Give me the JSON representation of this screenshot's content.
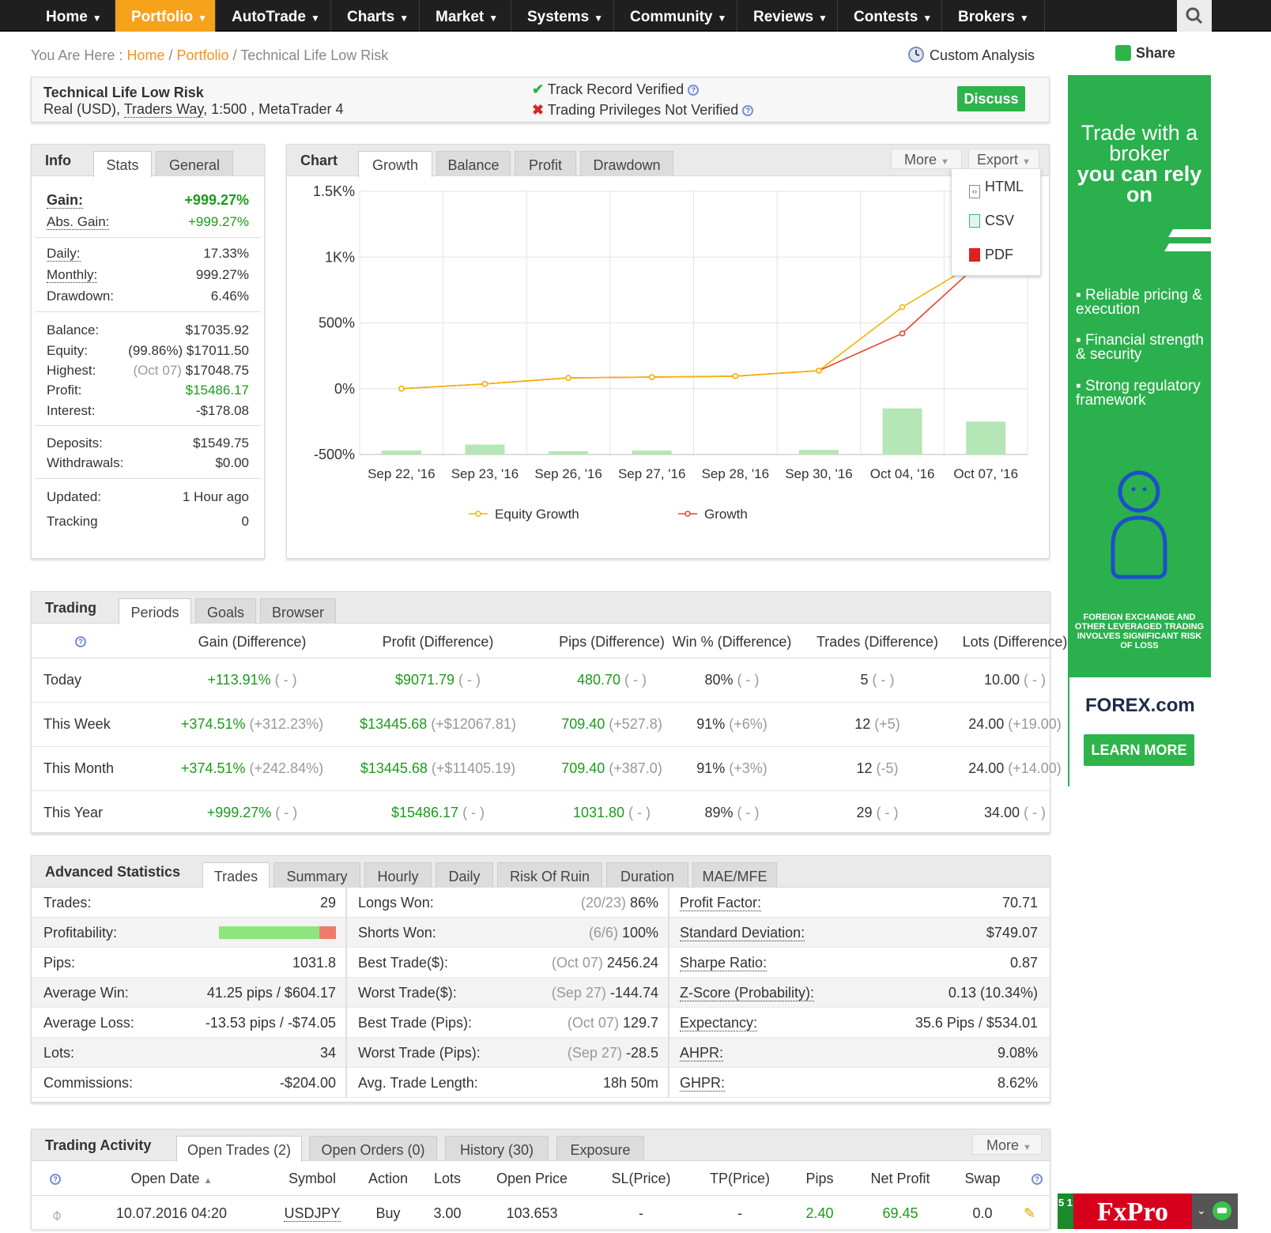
{
  "nav": {
    "items": [
      "Home",
      "Portfolio",
      "AutoTrade",
      "Charts",
      "Market",
      "Systems",
      "Community",
      "Reviews",
      "Contests",
      "Brokers"
    ],
    "active": "Portfolio"
  },
  "breadcrumb": {
    "prefix": "You Are Here :",
    "home": "Home",
    "portfolio": "Portfolio",
    "current": "Technical Life Low Risk"
  },
  "custom_analysis": "Custom Analysis",
  "share": "Share",
  "header": {
    "title": "Technical Life Low Risk",
    "sub_prefix": "Real (USD),",
    "broker": "Traders Way",
    "sub_suffix": ", 1:500 , MetaTrader 4",
    "track": "Track Record Verified",
    "privileges": "Trading Privileges Not Verified",
    "discuss": "Discuss"
  },
  "info": {
    "title": "Info",
    "tabs": [
      "Stats",
      "General"
    ],
    "gain_label": "Gain:",
    "gain": "+999.27%",
    "abs_gain_label": "Abs. Gain:",
    "abs_gain": "+999.27%",
    "daily_label": "Daily:",
    "daily": "17.33%",
    "monthly_label": "Monthly:",
    "monthly": "999.27%",
    "drawdown_label": "Drawdown:",
    "drawdown": "6.46%",
    "balance_label": "Balance:",
    "balance": "$17035.92",
    "equity_label": "Equity:",
    "equity_pct": "(99.86%)",
    "equity": "$17011.50",
    "highest_label": "Highest:",
    "highest_date": "(Oct 07)",
    "highest": "$17048.75",
    "profit_label": "Profit:",
    "profit": "$15486.17",
    "interest_label": "Interest:",
    "interest": "-$178.08",
    "deposits_label": "Deposits:",
    "deposits": "$1549.75",
    "withdrawals_label": "Withdrawals:",
    "withdrawals": "$0.00",
    "updated_label": "Updated:",
    "updated": "1 Hour ago",
    "tracking_label": "Tracking",
    "tracking": "0"
  },
  "chart_panel": {
    "title": "Chart",
    "tabs": [
      "Growth",
      "Balance",
      "Profit",
      "Drawdown"
    ],
    "more": "More",
    "export": "Export",
    "export_items": [
      "HTML",
      "CSV",
      "PDF"
    ]
  },
  "chart_data": {
    "type": "line",
    "categories": [
      "Sep 22, '16",
      "Sep 23, '16",
      "Sep 26, '16",
      "Sep 27, '16",
      "Sep 28, '16",
      "Sep 30, '16",
      "Oct 04, '16",
      "Oct 07, '16"
    ],
    "y_ticks": [
      "1.5K%",
      "1K%",
      "500%",
      "0%",
      "-500%"
    ],
    "ylim": [
      -500,
      1500
    ],
    "series": [
      {
        "name": "Equity Growth",
        "color": "#f5b400",
        "values": [
          0,
          36,
          82,
          88,
          95,
          137,
          620,
          999
        ]
      },
      {
        "name": "Growth",
        "color": "#e8422c",
        "values": [
          0,
          36,
          82,
          88,
          95,
          137,
          420,
          999
        ]
      }
    ],
    "bars": {
      "color": "#b5e6b5",
      "values": [
        -470,
        -425,
        -475,
        -470,
        -500,
        -465,
        -150,
        -250
      ]
    }
  },
  "trading": {
    "title": "Trading",
    "tabs": [
      "Periods",
      "Goals",
      "Browser"
    ],
    "columns": [
      "Gain (Difference)",
      "Profit (Difference)",
      "Pips (Difference)",
      "Win % (Difference)",
      "Trades (Difference)",
      "Lots (Difference)"
    ],
    "rows": [
      {
        "period": "Today",
        "gain": "+113.91%",
        "gain_d": "( - )",
        "profit": "$9071.79",
        "profit_d": "( - )",
        "pips": "480.70",
        "pips_d": "( - )",
        "win": "80%",
        "win_d": "( - )",
        "trades": "5",
        "trades_d": "( - )",
        "lots": "10.00",
        "lots_d": "( - )"
      },
      {
        "period": "This Week",
        "gain": "+374.51%",
        "gain_d": "(+312.23%)",
        "profit": "$13445.68",
        "profit_d": "(+$12067.81)",
        "pips": "709.40",
        "pips_d": "(+527.8)",
        "win": "91%",
        "win_d": "(+6%)",
        "trades": "12",
        "trades_d": "(+5)",
        "lots": "24.00",
        "lots_d": "(+19.00)"
      },
      {
        "period": "This Month",
        "gain": "+374.51%",
        "gain_d": "(+242.84%)",
        "profit": "$13445.68",
        "profit_d": "(+$11405.19)",
        "pips": "709.40",
        "pips_d": "(+387.0)",
        "win": "91%",
        "win_d": "(+3%)",
        "trades": "12",
        "trades_d": "(-5)",
        "lots": "24.00",
        "lots_d": "(+14.00)"
      },
      {
        "period": "This Year",
        "gain": "+999.27%",
        "gain_d": "( - )",
        "profit": "$15486.17",
        "profit_d": "( - )",
        "pips": "1031.80",
        "pips_d": "( - )",
        "win": "89%",
        "win_d": "( - )",
        "trades": "29",
        "trades_d": "( - )",
        "lots": "34.00",
        "lots_d": "( - )"
      }
    ]
  },
  "adv": {
    "title": "Advanced Statistics",
    "tabs": [
      "Trades",
      "Summary",
      "Hourly",
      "Daily",
      "Risk Of Ruin",
      "Duration",
      "MAE/MFE"
    ],
    "col1": [
      [
        "Trades:",
        "29"
      ],
      [
        "Profitability:",
        ""
      ],
      [
        "Pips:",
        "1031.8"
      ],
      [
        "Average Win:",
        "41.25 pips / $604.17"
      ],
      [
        "Average Loss:",
        "-13.53 pips / -$74.05"
      ],
      [
        "Lots:",
        "34"
      ],
      [
        "Commissions:",
        "-$204.00"
      ]
    ],
    "profitability": 0.86,
    "col2": [
      [
        "Longs Won:",
        "(20/23)",
        "86%"
      ],
      [
        "Shorts Won:",
        "(6/6)",
        "100%"
      ],
      [
        "Best Trade($):",
        "(Oct 07)",
        "2456.24"
      ],
      [
        "Worst Trade($):",
        "(Sep 27)",
        "-144.74"
      ],
      [
        "Best Trade (Pips):",
        "(Oct 07)",
        "129.7"
      ],
      [
        "Worst Trade (Pips):",
        "(Sep 27)",
        "-28.5"
      ],
      [
        "Avg. Trade Length:",
        "",
        "18h 50m"
      ]
    ],
    "col3": [
      [
        "Profit Factor:",
        "70.71"
      ],
      [
        "Standard Deviation:",
        "$749.07"
      ],
      [
        "Sharpe Ratio:",
        "0.87"
      ],
      [
        "Z-Score (Probability):",
        "0.13 (10.34%)"
      ],
      [
        "Expectancy:",
        "35.6 Pips / $534.01"
      ],
      [
        "AHPR:",
        "9.08%"
      ],
      [
        "GHPR:",
        "8.62%"
      ]
    ]
  },
  "activity": {
    "title": "Trading Activity",
    "tabs": [
      "Open Trades (2)",
      "Open Orders (0)",
      "History (30)",
      "Exposure"
    ],
    "more": "More",
    "columns": [
      "Open Date",
      "Symbol",
      "Action",
      "Lots",
      "Open Price",
      "SL(Price)",
      "TP(Price)",
      "Pips",
      "Net Profit",
      "Swap"
    ],
    "row": {
      "date": "10.07.2016 04:20",
      "symbol": "USDJPY",
      "action": "Buy",
      "lots": "3.00",
      "price": "103.653",
      "sl": "-",
      "tp": "-",
      "pips": "2.40",
      "profit": "69.45",
      "swap": "0.0"
    }
  },
  "ad": {
    "line1": "Trade with a",
    "line2": "broker",
    "line3": "you can rely",
    "line4": "on",
    "b1": "Reliable pricing & execution",
    "b2": "Financial strength & security",
    "b3": "Strong regulatory framework",
    "warn": "FOREIGN EXCHANGE AND OTHER LEVERAGED TRADING INVOLVES SIGNIFICANT RISK OF LOSS",
    "brand": "FOREX.com",
    "cta": "LEARN MORE"
  },
  "fxpro": {
    "label": "FxPro",
    "badge": "5 1"
  }
}
